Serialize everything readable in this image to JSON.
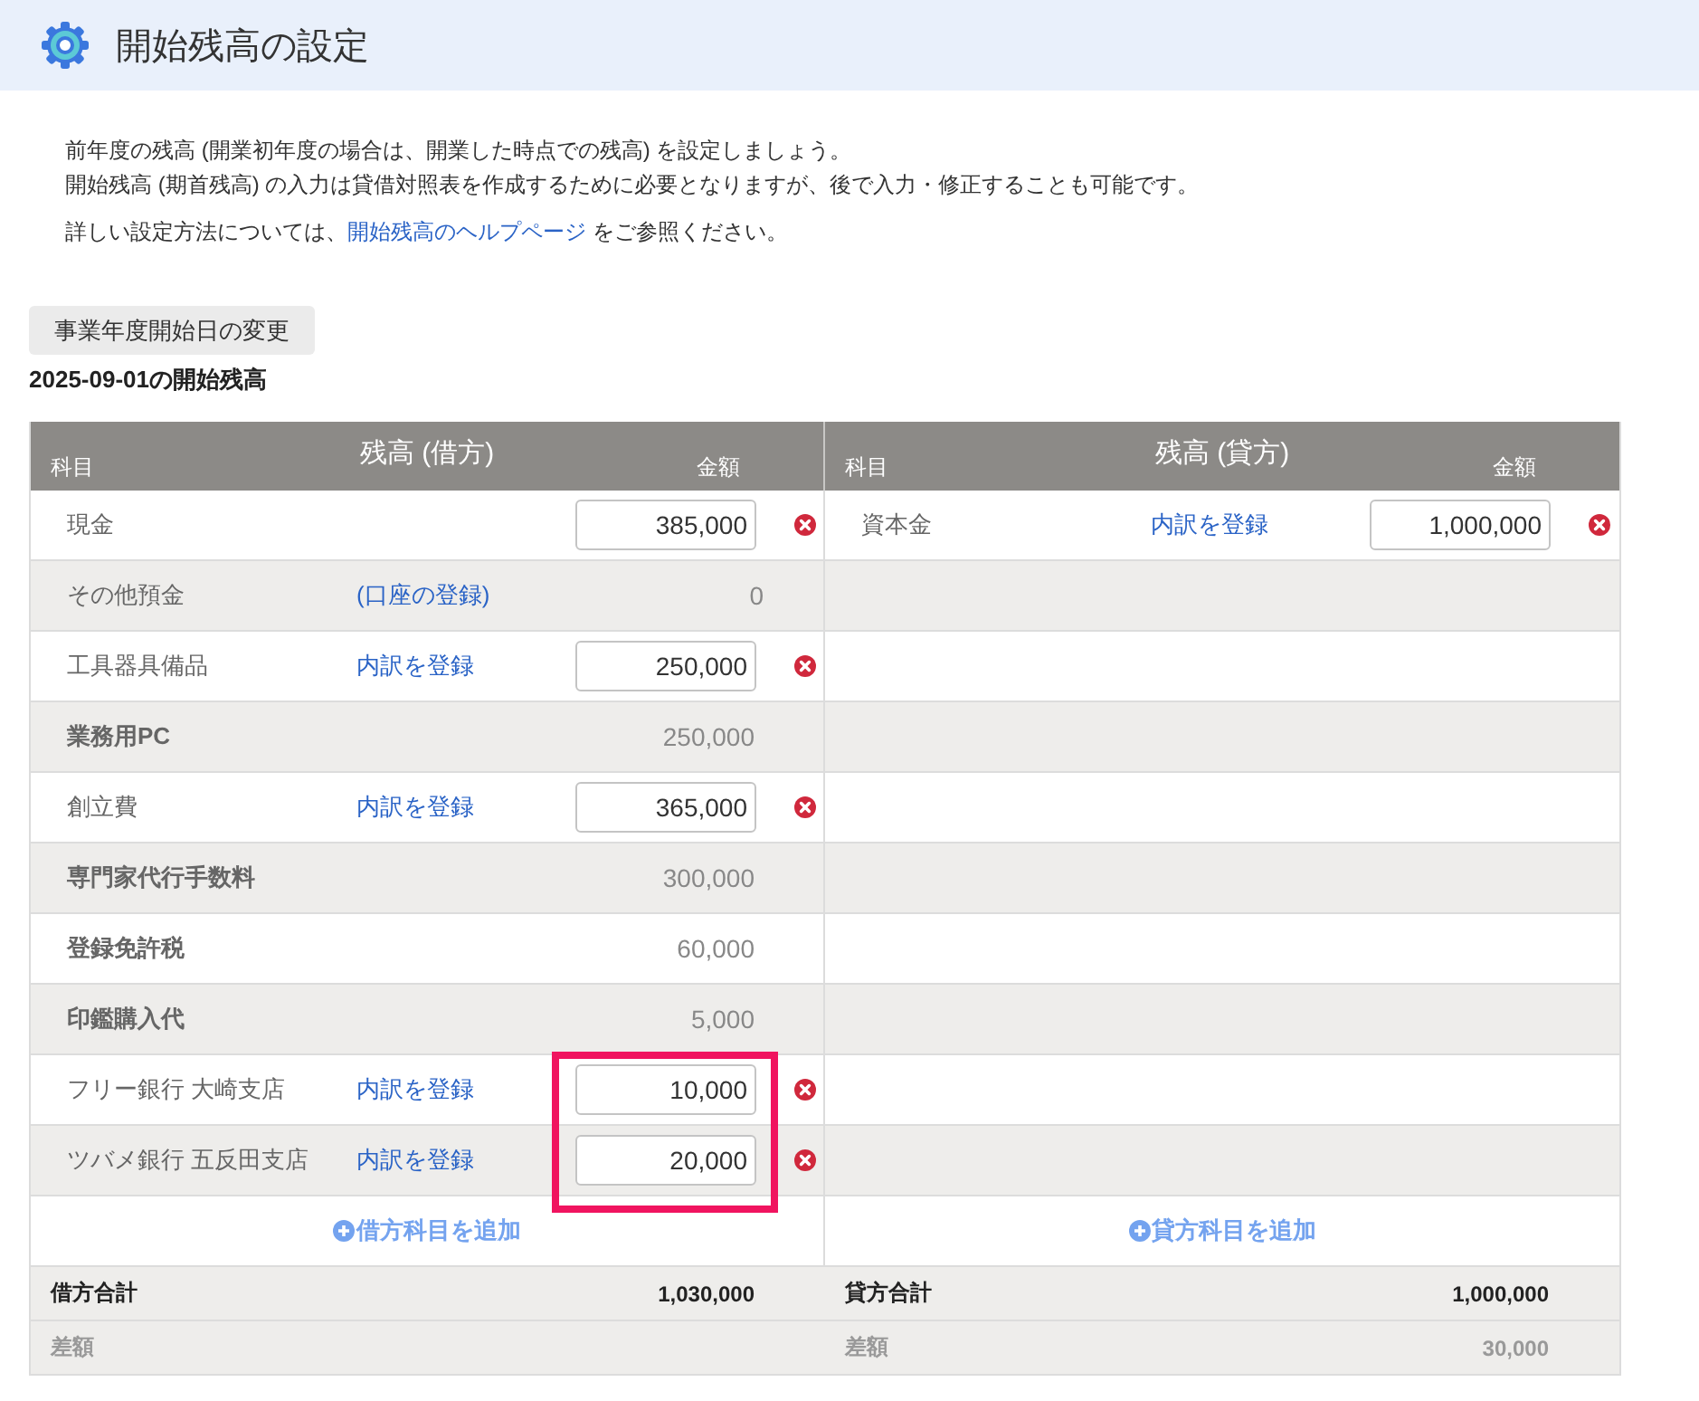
{
  "header": {
    "title": "開始残高の設定"
  },
  "intro": {
    "lines": [
      "前年度の残高 (開業初年度の場合は、開業した時点での残高) を設定しましょう。",
      "開始残高 (期首残高) の入力は貸借対照表を作成するために必要となりますが、後で入力・修正することも可能です。"
    ],
    "help": {
      "before": "詳しい設定方法については、",
      "link": "開始残高のヘルプページ",
      "after": " をご参照ください。"
    }
  },
  "change_start_date_button": "事業年度開始日の変更",
  "balance_heading": "2025-09-01の開始残高",
  "debit": {
    "title": "残高 (借方)",
    "account_column": "科目",
    "amount_column": "金額",
    "rows": [
      {
        "kind": "entry",
        "account": "現金",
        "amount": "385,000",
        "highlighted": false
      },
      {
        "kind": "summary",
        "account": "その他預金",
        "link": "(口座の登録)",
        "amount": "0",
        "highlighted": false
      },
      {
        "kind": "entry",
        "account": "工具器具備品",
        "link": "内訳を登録",
        "amount": "250,000",
        "highlighted": false
      },
      {
        "kind": "breakdown",
        "account": "業務用PC",
        "amount": "250,000",
        "highlighted": false
      },
      {
        "kind": "entry",
        "account": "創立費",
        "link": "内訳を登録",
        "amount": "365,000",
        "highlighted": false
      },
      {
        "kind": "breakdown",
        "account": "専門家代行手数料",
        "amount": "300,000",
        "highlighted": false
      },
      {
        "kind": "breakdown",
        "account": "登録免許税",
        "amount": "60,000",
        "highlighted": false
      },
      {
        "kind": "breakdown",
        "account": "印鑑購入代",
        "amount": "5,000",
        "highlighted": false
      },
      {
        "kind": "entry",
        "account": "フリー銀行 大崎支店",
        "link": "内訳を登録",
        "amount": "10,000",
        "highlighted": true
      },
      {
        "kind": "entry",
        "account": "ツバメ銀行 五反田支店",
        "link": "内訳を登録",
        "amount": "20,000",
        "highlighted": true
      }
    ],
    "add_button": "借方科目を追加",
    "total": {
      "label": "借方合計",
      "amount": "1,030,000"
    },
    "difference": {
      "label": "差額"
    }
  },
  "credit": {
    "title": "残高 (貸方)",
    "account_column": "科目",
    "amount_column": "金額",
    "rows": [
      {
        "kind": "entry",
        "account": "資本金",
        "link": "内訳を登録",
        "amount": "1,000,000",
        "highlighted": false
      }
    ],
    "add_button": "貸方科目を追加",
    "total": {
      "label": "貸方合計",
      "amount": "1,000,000"
    },
    "difference": {
      "label": "差額",
      "amount": "30,000"
    }
  }
}
